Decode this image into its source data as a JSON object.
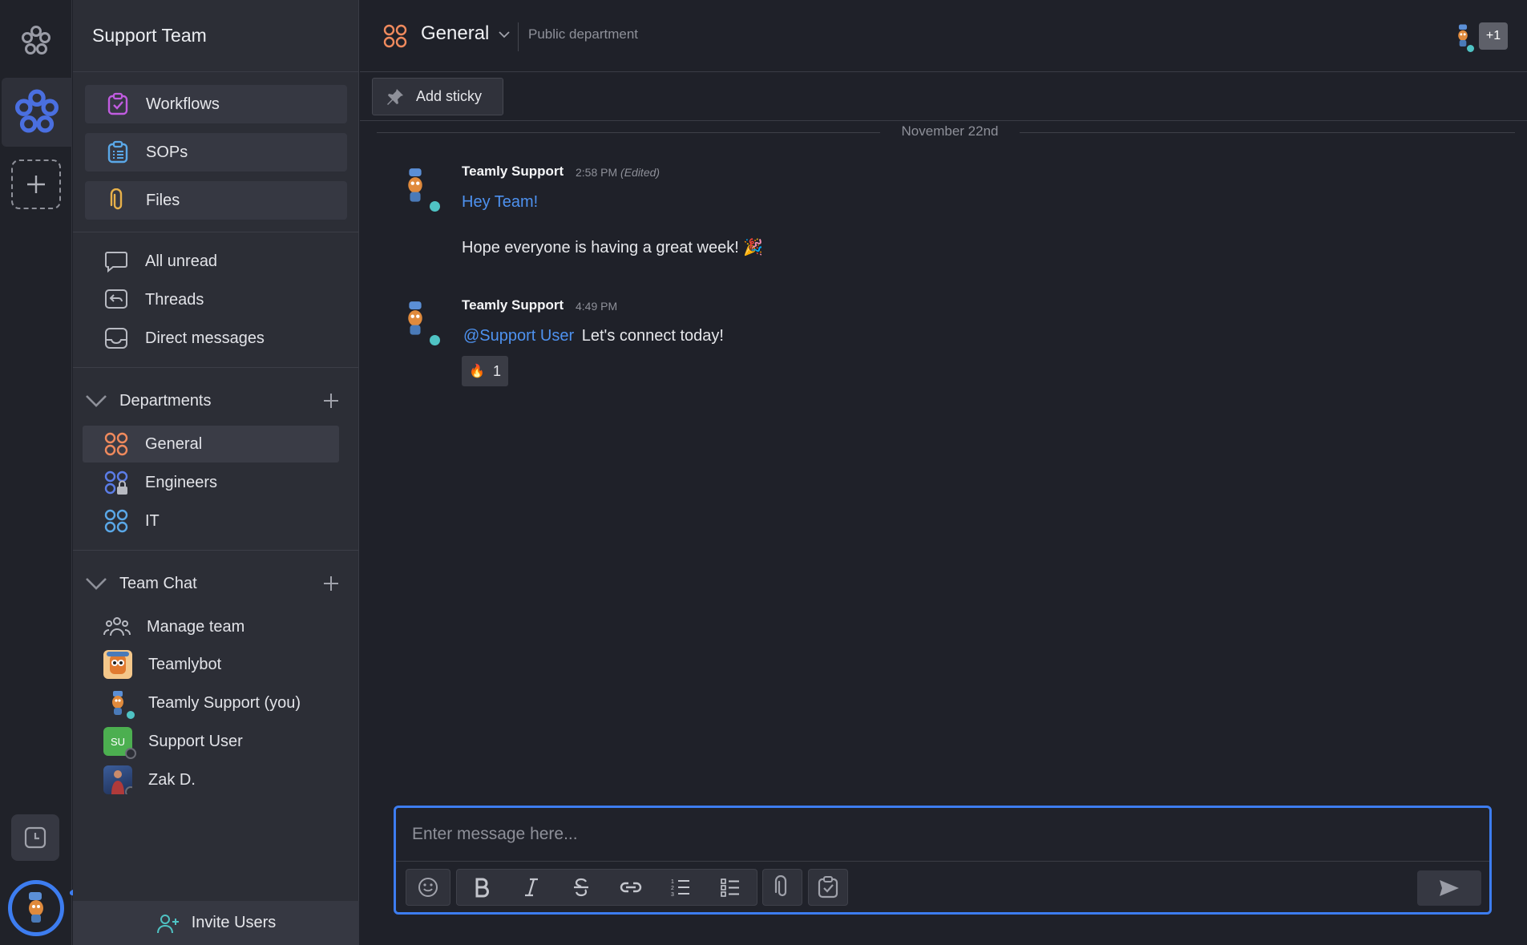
{
  "workspace": {
    "name": "Support Team"
  },
  "sidebar": {
    "cards": [
      {
        "label": "Workflows",
        "icon": "workflows-icon"
      },
      {
        "label": "SOPs",
        "icon": "sops-icon"
      },
      {
        "label": "Files",
        "icon": "paperclip-icon"
      }
    ],
    "nav": [
      {
        "label": "All unread",
        "icon": "chat-bubble-icon"
      },
      {
        "label": "Threads",
        "icon": "threads-icon"
      },
      {
        "label": "Direct messages",
        "icon": "inbox-icon"
      }
    ],
    "departments": {
      "title": "Departments",
      "items": [
        {
          "label": "General",
          "color": "#f08a5d",
          "active": true
        },
        {
          "label": "Engineers",
          "color": "#5b7de8",
          "locked": true
        },
        {
          "label": "IT",
          "color": "#5aa8e8"
        }
      ]
    },
    "team_chat": {
      "title": "Team Chat",
      "items": [
        {
          "label": "Manage team",
          "icon": "team-icon"
        },
        {
          "label": "Teamlybot",
          "icon": "bot-avatar"
        },
        {
          "label": "Teamly Support (you)",
          "icon": "mascot-avatar",
          "status": "online"
        },
        {
          "label": "Support User",
          "initials": "SU",
          "color": "#4caf50",
          "status": "offline"
        },
        {
          "label": "Zak D.",
          "icon": "photo-avatar",
          "status": "offline"
        }
      ]
    },
    "invite_label": "Invite Users"
  },
  "channel": {
    "title": "General",
    "subtitle": "Public department",
    "member_overflow": "+1",
    "sticky_label": "Add sticky"
  },
  "messages": {
    "date_divider": "November 22nd",
    "items": [
      {
        "author": "Teamly Support",
        "time": "2:58 PM",
        "edited": "(Edited)",
        "line1": "Hey Team!",
        "line2": "Hope everyone is having a great week! 🎉"
      },
      {
        "author": "Teamly Support",
        "time": "4:49 PM",
        "mention": "@Support User",
        "text": "Let's connect today!",
        "reaction": {
          "emoji": "🔥",
          "count": "1"
        }
      }
    ]
  },
  "composer": {
    "placeholder": "Enter message here...",
    "tools": [
      "emoji-icon",
      "bold-icon",
      "italic-icon",
      "strikethrough-icon",
      "link-icon",
      "numbered-list-icon",
      "bullet-list-icon",
      "attach-icon",
      "task-icon",
      "send-icon"
    ]
  },
  "colors": {
    "accent": "#3d7df0",
    "online": "#4fc3c4",
    "annotation": "#3d7df0"
  }
}
